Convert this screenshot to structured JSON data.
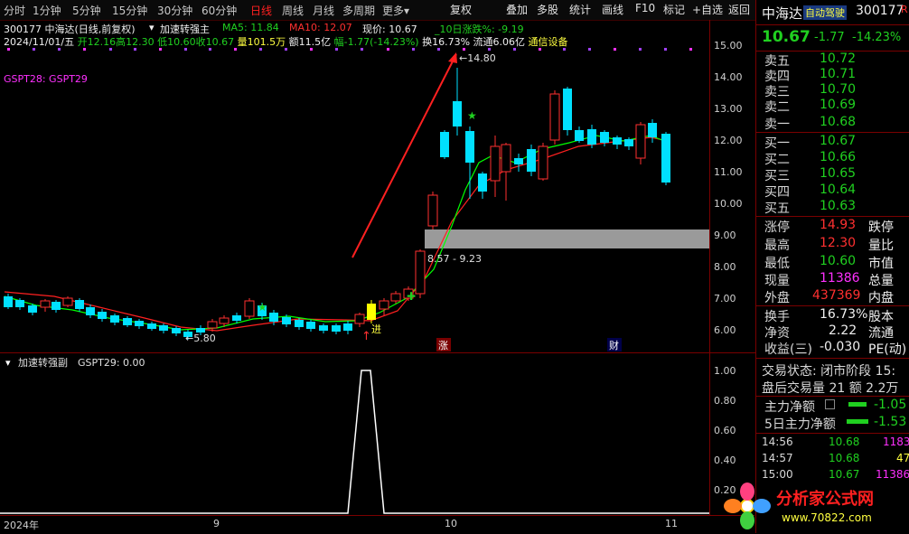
{
  "toolbar": {
    "periods": [
      "分时",
      "1分钟",
      "5分钟",
      "15分钟",
      "30分钟",
      "60分钟",
      "日线",
      "周线",
      "月线",
      "多周期",
      "更多"
    ],
    "active_period": "日线",
    "buttons": [
      "复权",
      "叠加",
      "多股",
      "统计",
      "画线",
      "F10",
      "标记",
      "+自选",
      "返回"
    ]
  },
  "info": {
    "code_name": "300177 中海达(日线,前复权)",
    "indicator": "加速转强主",
    "ma5": "MA5: 11.84",
    "ma10": "MA10: 12.07",
    "price": "现价: 10.67",
    "chg10": "_10日涨跌%: -9.19",
    "date": "2024/11/01/五",
    "open": "开12.16",
    "high": "高12.30",
    "low": "低10.60",
    "close": "收10.67",
    "vol": "量101.5万",
    "amount": "额11.5亿",
    "amp": "幅-1.77(-14.23%)",
    "turnover": "换16.73%",
    "float": "流通6.06亿",
    "sector": "通信设备",
    "legend": "GSPT28: GSPT29",
    "sub_title": "加速转强副",
    "sub_value": "GSPT29: 0.00"
  },
  "annotations": {
    "high_label": "14.80",
    "low_label": "5.80",
    "range_label": "8.57 - 9.23",
    "enter_label": "进",
    "zhang_badge": "涨",
    "cai_badge": "财"
  },
  "main_axis": [
    "15.00",
    "14.00",
    "13.00",
    "12.00",
    "11.00",
    "10.00",
    "9.00",
    "8.00",
    "7.00",
    "6.00"
  ],
  "sub_axis": [
    "1.00",
    "0.80",
    "0.60",
    "0.40",
    "0.20"
  ],
  "date_axis": [
    "2024年",
    "9",
    "10",
    "11"
  ],
  "panel": {
    "stock_name": "中海达",
    "badge": "自动驾驶",
    "code": "300177",
    "r_mark": "R",
    "price": "10.67",
    "change": "-1.77",
    "change_pct": "-14.23%",
    "asks": [
      {
        "label": "卖五",
        "price": "10.72"
      },
      {
        "label": "卖四",
        "price": "10.71"
      },
      {
        "label": "卖三",
        "price": "10.70"
      },
      {
        "label": "卖二",
        "price": "10.69"
      },
      {
        "label": "卖一",
        "price": "10.68"
      }
    ],
    "bids": [
      {
        "label": "买一",
        "price": "10.67"
      },
      {
        "label": "买二",
        "price": "10.66"
      },
      {
        "label": "买三",
        "price": "10.65"
      },
      {
        "label": "买四",
        "price": "10.64"
      },
      {
        "label": "买五",
        "price": "10.63"
      }
    ],
    "stats": [
      {
        "label": "涨停",
        "value": "14.93",
        "label2": "跌停"
      },
      {
        "label": "最高",
        "value": "12.30",
        "label2": "量比"
      },
      {
        "label": "最低",
        "value": "10.60",
        "label2": "市值"
      },
      {
        "label": "现量",
        "value": "11386",
        "label2": "总量"
      },
      {
        "label": "外盘",
        "value": "437369",
        "label2": "内盘"
      }
    ],
    "stats2": [
      {
        "label": "换手",
        "value": "16.73%",
        "label2": "股本"
      },
      {
        "label": "净资",
        "value": "2.22",
        "label2": "流通"
      },
      {
        "label": "收益(三)",
        "value": "-0.030",
        "label2": "PE(动)"
      }
    ],
    "trade_status": "交易状态: 闭市阶段 15:",
    "after_hours": "盘后交易量 21 额 2.2万",
    "main_net": "主力净额",
    "main_net_val": "-1.05",
    "main_net5": "5日主力净额",
    "main_net5_val": "-1.53",
    "ticks": [
      {
        "time": "14:56",
        "price": "10.68",
        "vol": "1183"
      },
      {
        "time": "14:57",
        "price": "10.68",
        "vol": "47"
      },
      {
        "time": "15:00",
        "price": "10.67",
        "vol": "11386"
      }
    ],
    "watermark": "分析家公式网",
    "watermark_url": "www.70822.com"
  },
  "colors": {
    "up": "#ff3030",
    "down": "#00e0ff",
    "ma5": "#00ff00",
    "ma10": "#ff2020",
    "band": "#9a9a9a"
  }
}
